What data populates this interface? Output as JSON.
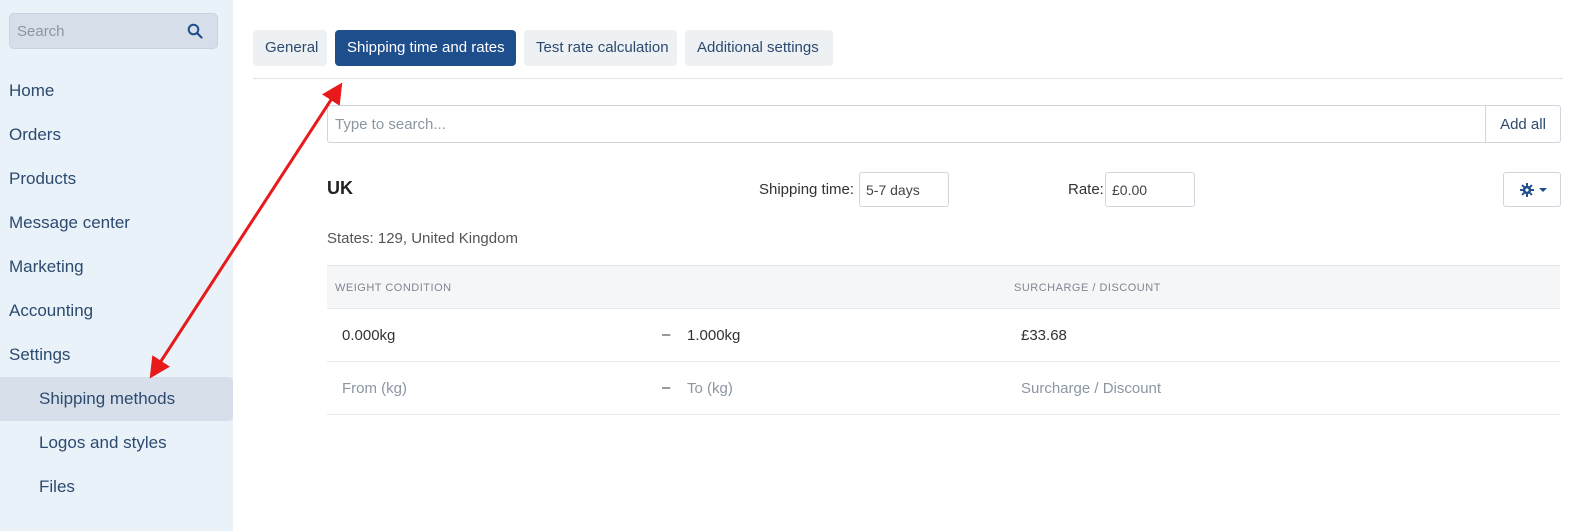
{
  "sidebar": {
    "search_placeholder": "Search",
    "items": [
      {
        "label": "Home"
      },
      {
        "label": "Orders"
      },
      {
        "label": "Products"
      },
      {
        "label": "Message center"
      },
      {
        "label": "Marketing"
      },
      {
        "label": "Accounting"
      },
      {
        "label": "Settings"
      },
      {
        "label": "Shipping methods"
      },
      {
        "label": "Logos and styles"
      },
      {
        "label": "Files"
      }
    ]
  },
  "tabs": [
    {
      "label": "General"
    },
    {
      "label": "Shipping time and rates"
    },
    {
      "label": "Test rate calculation"
    },
    {
      "label": "Additional settings"
    }
  ],
  "search": {
    "placeholder": "Type to search...",
    "add_all_label": "Add all"
  },
  "zone": {
    "name": "UK",
    "shipping_time_label": "Shipping time:",
    "shipping_time_value": "5-7 days",
    "rate_label": "Rate:",
    "rate_value": "£0.00",
    "states_text": "States: 129, United Kingdom"
  },
  "table": {
    "headers": {
      "weight_condition": "Weight condition",
      "surcharge": "Surcharge / Discount"
    },
    "rows": [
      {
        "from": "0.000kg",
        "dash": "–",
        "to": "1.000kg",
        "surcharge": "£33.68"
      }
    ],
    "placeholder_row": {
      "from": "From (kg)",
      "dash": "–",
      "to": "To (kg)",
      "surcharge": "Surcharge / Discount"
    }
  },
  "colors": {
    "accent": "#1f4e8c",
    "sidebar_bg": "#e9f1f9",
    "annotation_arrow": "#e8191a"
  },
  "icons": {
    "search": "search-icon",
    "settings": "gear-icon"
  }
}
